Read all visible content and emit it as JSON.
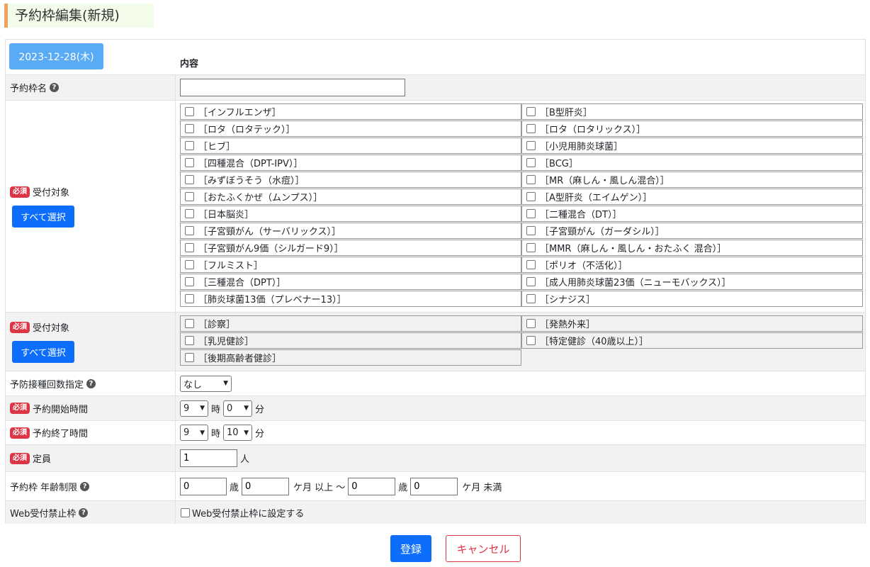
{
  "title": "予約枠編集(新規)",
  "date_button": "2023-12-28(木)",
  "content_header": "内容",
  "slot_name": {
    "label": "予約枠名",
    "value": ""
  },
  "required_badge": "必須",
  "target1": {
    "label": "受付対象",
    "select_all": "すべて選択",
    "items": [
      "［インフルエンザ］",
      "［B型肝炎］",
      "［ロタ（ロタテック）］",
      "［ロタ（ロタリックス）］",
      "［ヒブ］",
      "［小児用肺炎球菌］",
      "［四種混合（DPT-IPV）］",
      "［BCG］",
      "［みずぼうそう（水痘）］",
      "［MR（麻しん・風しん混合）］",
      "［おたふくかぜ（ムンプス）］",
      "［A型肝炎（エイムゲン）］",
      "［日本脳炎］",
      "［二種混合（DT）］",
      "［子宮頸がん（サーバリックス）］",
      "［子宮頸がん（ガーダシル）］",
      "［子宮頸がん9価（シルガード9）］",
      "［MMR（麻しん・風しん・おたふく 混合）］",
      "［フルミスト］",
      "［ポリオ（不活化）］",
      "［三種混合（DPT）］",
      "［成人用肺炎球菌23価（ニューモバックス）］",
      "［肺炎球菌13価（プレベナー13）］",
      "［シナジス］"
    ]
  },
  "target2": {
    "label": "受付対象",
    "select_all": "すべて選択",
    "items": [
      "［診察］",
      "［発熱外来］",
      "［乳児健診］",
      "［特定健診（40歳以上）］",
      "［後期高齢者健診］"
    ]
  },
  "dose_count": {
    "label": "予防接種回数指定",
    "value": "なし"
  },
  "start_time": {
    "label": "予約開始時間",
    "hour": "9",
    "minute": "0"
  },
  "end_time": {
    "label": "予約終了時間",
    "hour": "9",
    "minute": "10"
  },
  "capacity": {
    "label": "定員",
    "value": "1",
    "unit": "人"
  },
  "age_limit": {
    "label": "予約枠 年齢制限",
    "min_years": "0",
    "min_months": "0",
    "max_years": "0",
    "max_months": "0",
    "years_unit": "歳",
    "months_from_unit": "ケ月 以上 〜",
    "months_to_unit": "ケ月 未満"
  },
  "web_block": {
    "label": "Web受付禁止枠",
    "checkbox_label": "Web受付禁止枠に設定する"
  },
  "units": {
    "hour": "時",
    "minute": "分"
  },
  "buttons": {
    "submit": "登録",
    "cancel": "キャンセル"
  }
}
